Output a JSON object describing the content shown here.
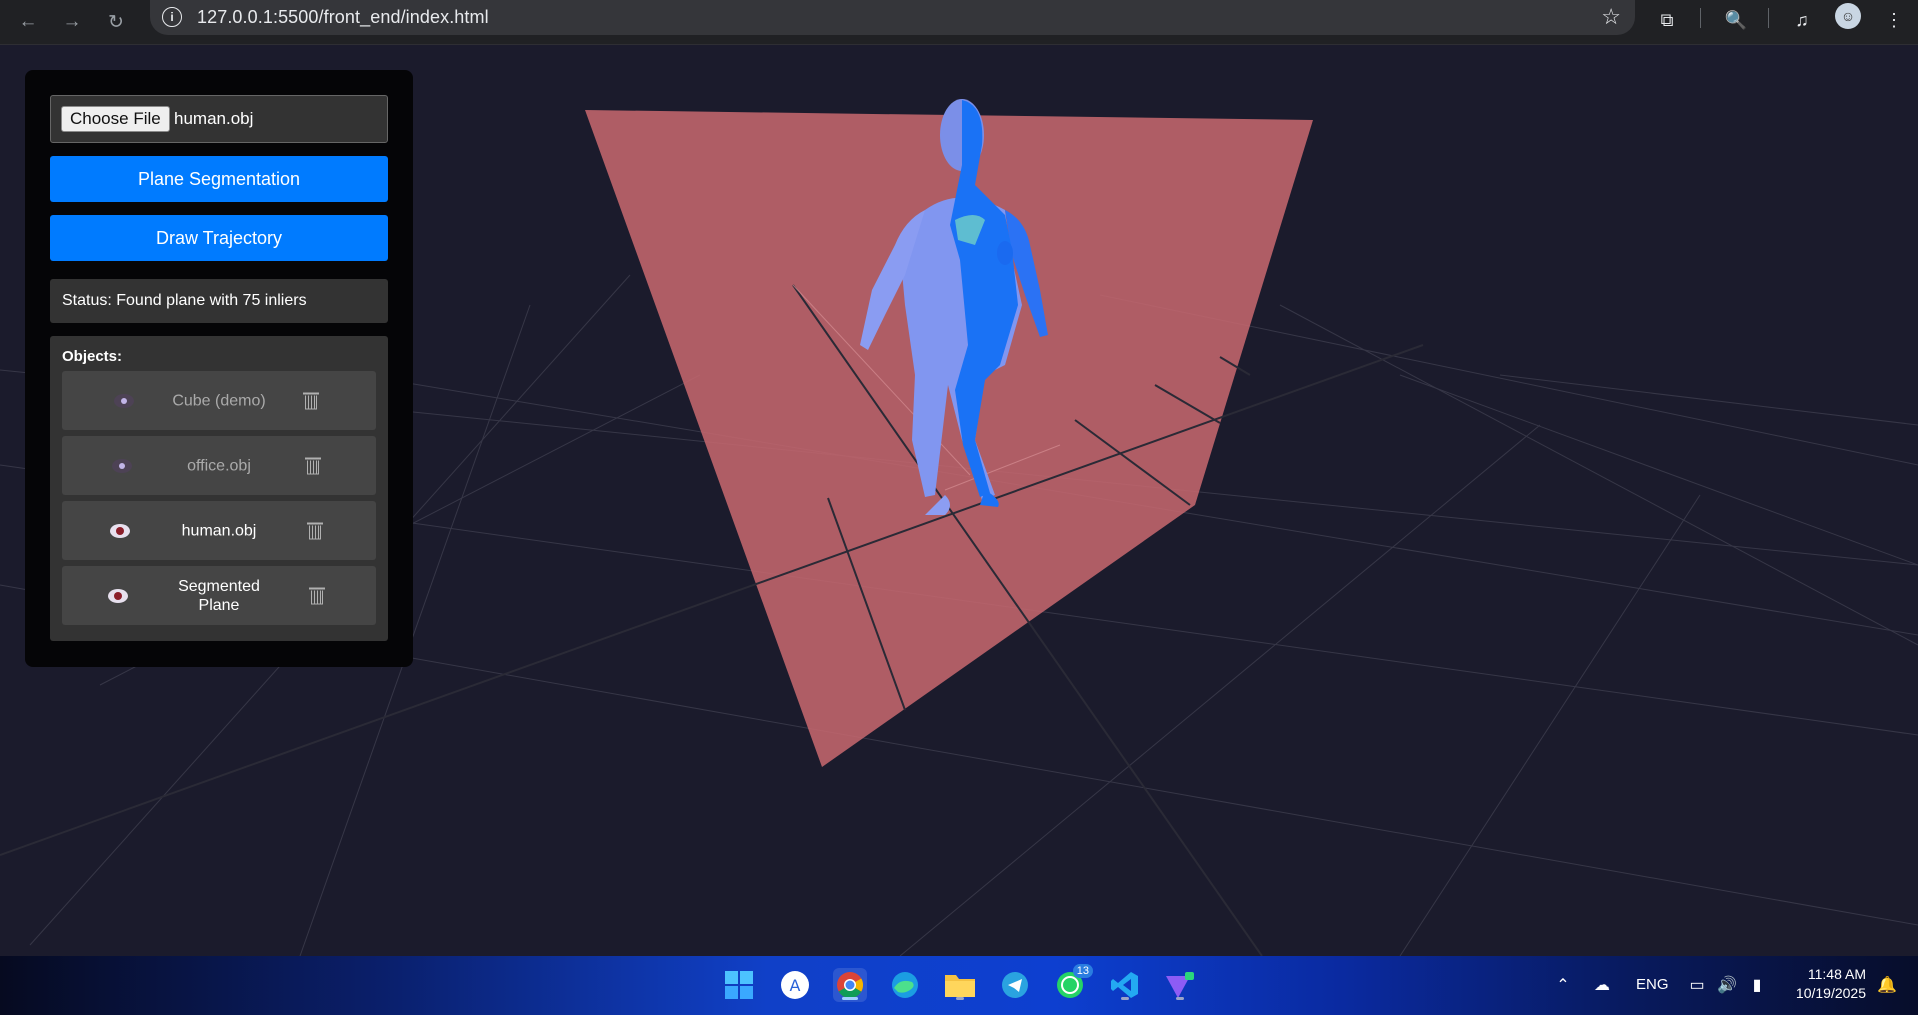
{
  "browser": {
    "url": "127.0.0.1:5500/front_end/index.html"
  },
  "panel": {
    "choose_file_label": "Choose File",
    "file_name": "human.obj",
    "plane_segmentation_label": "Plane Segmentation",
    "draw_trajectory_label": "Draw Trajectory",
    "status_text": "Status: Found plane with 75 inliers",
    "objects_title": "Objects:",
    "objects": [
      {
        "name": "Cube (demo)",
        "visible": false
      },
      {
        "name": "office.obj",
        "visible": false
      },
      {
        "name": "human.obj",
        "visible": true
      },
      {
        "name": "Segmented Plane",
        "visible": true
      }
    ]
  },
  "taskbar": {
    "whatsapp_badge": "13",
    "language": "ENG",
    "time": "11:48 AM",
    "date": "10/19/2025"
  },
  "colors": {
    "accent_button": "#007bff",
    "plane": "#c96970",
    "figure": "#1f7cff"
  }
}
